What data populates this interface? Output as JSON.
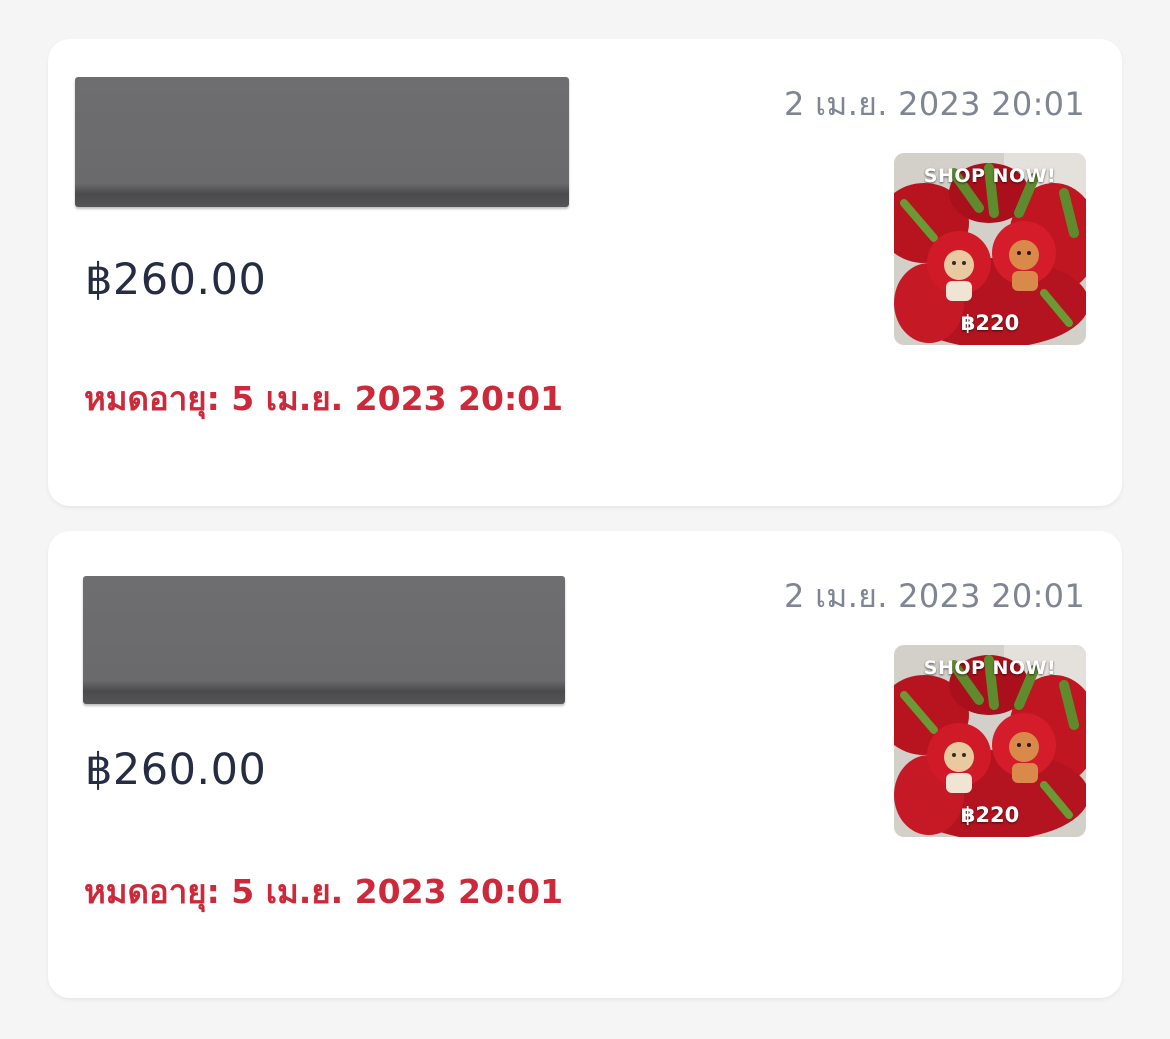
{
  "vouchers": [
    {
      "date": "2 เม.ย. 2023 20:01",
      "price": "฿260.00",
      "expiry": "หมดอายุ: 5 เม.ย. 2023 20:01",
      "thumbnail": {
        "headline": "SHOP NOW!",
        "price": "฿220"
      }
    },
    {
      "date": "2 เม.ย. 2023 20:01",
      "price": "฿260.00",
      "expiry": "หมดอายุ: 5 เม.ย. 2023 20:01",
      "thumbnail": {
        "headline": "SHOP NOW!",
        "price": "฿220"
      }
    }
  ],
  "colors": {
    "background": "#f5f5f6",
    "card": "#ffffff",
    "date_text": "#7f8593",
    "price_text": "#252c43",
    "expiry_text": "#cc2a3b",
    "redaction": "#6b6b6d"
  }
}
